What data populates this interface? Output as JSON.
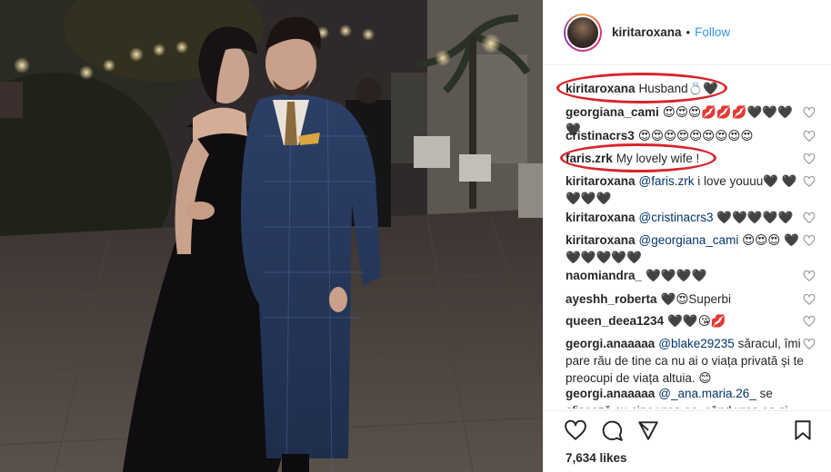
{
  "photo": {
    "alt_subject": "couple-photo"
  },
  "header": {
    "username": "kiritaroxana",
    "separator": "•",
    "follow_label": "Follow"
  },
  "comments": [
    {
      "user": "kiritaroxana",
      "parts": [
        {
          "t": "text",
          "v": "Husband💍🖤"
        }
      ],
      "heart": false,
      "highlighted": true
    },
    {
      "user": "georgiana_cami",
      "parts": [
        {
          "t": "text",
          "v": "😍😍😍💋💋💋🖤🖤🖤🖤"
        }
      ],
      "heart": true
    },
    {
      "user": "cristinacrs3",
      "parts": [
        {
          "t": "text",
          "v": "😍😍😍😍😍😍😍😍😍"
        }
      ],
      "heart": true
    },
    {
      "user": "faris.zrk",
      "parts": [
        {
          "t": "text",
          "v": "My lovely wife !"
        }
      ],
      "heart": true,
      "highlighted": true
    },
    {
      "user": "kiritaroxana",
      "parts": [
        {
          "t": "mention",
          "v": "@faris.zrk"
        },
        {
          "t": "text",
          "v": " i love youuu🖤 🖤🖤🖤🖤"
        }
      ],
      "heart": true
    },
    {
      "user": "kiritaroxana",
      "parts": [
        {
          "t": "mention",
          "v": "@cristinacrs3"
        },
        {
          "t": "text",
          "v": " 🖤🖤🖤🖤🖤"
        }
      ],
      "heart": true
    },
    {
      "user": "kiritaroxana",
      "parts": [
        {
          "t": "mention",
          "v": "@georgiana_cami"
        },
        {
          "t": "text",
          "v": " 😍😍😍 🖤🖤🖤🖤🖤🖤"
        }
      ],
      "heart": true
    },
    {
      "user": "naomiandra_",
      "parts": [
        {
          "t": "text",
          "v": "🖤🖤🖤🖤"
        }
      ],
      "heart": true
    },
    {
      "user": "ayeshh_roberta",
      "parts": [
        {
          "t": "text",
          "v": "🖤😍Superbi"
        }
      ],
      "heart": true
    },
    {
      "user": "queen_deea1234",
      "parts": [
        {
          "t": "text",
          "v": "🖤🖤😘💋"
        }
      ],
      "heart": true
    },
    {
      "user": "georgi.anaaaaa",
      "parts": [
        {
          "t": "mention",
          "v": "@blake29235"
        },
        {
          "t": "text",
          "v": " săracul, îmi pare rău de tine ca nu ai o viața privată și te preocupi de viața altuia. 😊"
        }
      ],
      "heart": true
    },
    {
      "user": "georgi.anaaaaa",
      "parts": [
        {
          "t": "mention",
          "v": "@_ana.maria.26_"
        },
        {
          "t": "text",
          "v": " se afișează cu cine vrea ea, când vrea ea și"
        }
      ],
      "heart": false
    }
  ],
  "actions": {
    "like_icon": "heart-outline-icon",
    "comment_icon": "comment-bubble-icon",
    "share_icon": "share-icon",
    "save_icon": "bookmark-icon",
    "likes_text": "7,634 likes"
  },
  "colors": {
    "highlight_oval": "#d8252b",
    "follow": "#3897f0",
    "mention": "#003569"
  }
}
